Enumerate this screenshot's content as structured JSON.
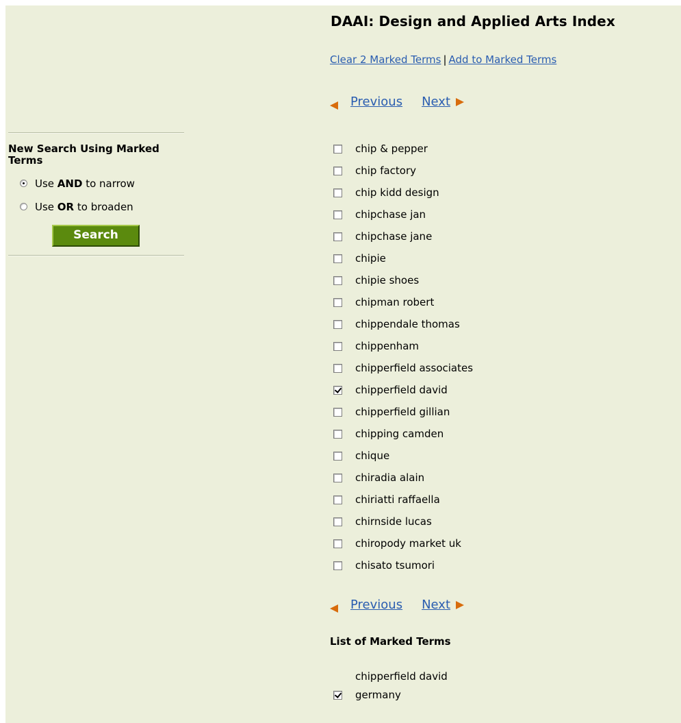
{
  "header": {
    "title": "DAAI: Design and Applied Arts Index"
  },
  "marked_links": {
    "clear": "Clear 2 Marked Terms",
    "separator": "|",
    "add": "Add to Marked Terms"
  },
  "pager": {
    "previous": "Previous",
    "next": "Next"
  },
  "sidebar": {
    "title": "New Search Using Marked Terms",
    "and_option": {
      "prefix": "Use ",
      "bold": "AND",
      "suffix": " to narrow",
      "selected": true
    },
    "or_option": {
      "prefix": "Use ",
      "bold": "OR",
      "suffix": " to broaden",
      "selected": false
    },
    "search_label": "Search"
  },
  "terms": [
    {
      "label": "chip & pepper",
      "checked": false
    },
    {
      "label": "chip factory",
      "checked": false
    },
    {
      "label": "chip kidd design",
      "checked": false
    },
    {
      "label": "chipchase jan",
      "checked": false
    },
    {
      "label": "chipchase jane",
      "checked": false
    },
    {
      "label": "chipie",
      "checked": false
    },
    {
      "label": "chipie shoes",
      "checked": false
    },
    {
      "label": "chipman robert",
      "checked": false
    },
    {
      "label": "chippendale thomas",
      "checked": false
    },
    {
      "label": "chippenham",
      "checked": false
    },
    {
      "label": "chipperfield associates",
      "checked": false
    },
    {
      "label": "chipperfield david",
      "checked": true
    },
    {
      "label": "chipperfield gillian",
      "checked": false
    },
    {
      "label": "chipping camden",
      "checked": false
    },
    {
      "label": "chique",
      "checked": false
    },
    {
      "label": "chiradia alain",
      "checked": false
    },
    {
      "label": "chiriatti raffaella",
      "checked": false
    },
    {
      "label": "chirnside lucas",
      "checked": false
    },
    {
      "label": "chiropody market uk",
      "checked": false
    },
    {
      "label": "chisato tsumori",
      "checked": false
    }
  ],
  "marked_terms": {
    "title": "List of Marked Terms",
    "line1": "chipperfield david",
    "line2": "germany",
    "checked": true
  },
  "colors": {
    "background": "#ecefdb",
    "link": "#2a5db0",
    "accent": "#d86c0c",
    "button": "#5b8a0e"
  }
}
